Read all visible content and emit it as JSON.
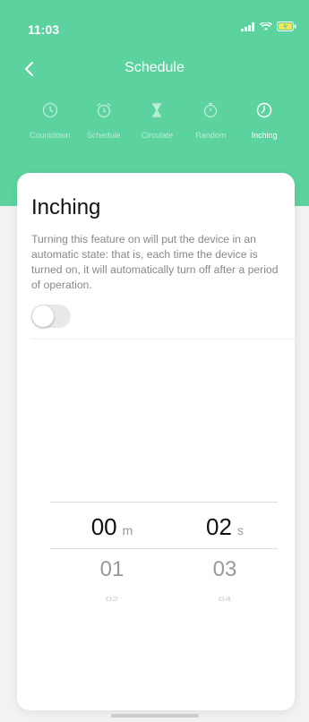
{
  "status": {
    "time": "11:03"
  },
  "header": {
    "title": "Schedule"
  },
  "tabs": [
    {
      "label": "Countdown",
      "icon": "clock-icon",
      "active": false
    },
    {
      "label": "Schedule",
      "icon": "alarm-clock-icon",
      "active": false
    },
    {
      "label": "Circulate",
      "icon": "hourglass-icon",
      "active": false
    },
    {
      "label": "Random",
      "icon": "stopwatch-icon",
      "active": false
    },
    {
      "label": "Inching",
      "icon": "clock-hand-icon",
      "active": true
    }
  ],
  "card": {
    "title": "Inching",
    "description": "Turning this feature on will put the device in an automatic state: that is, each time the device is turned on, it will automatically turn off after a period of operation.",
    "toggle_on": false
  },
  "picker": {
    "minutes": {
      "selected": "00",
      "unit": "m",
      "next": "01",
      "next2": "02"
    },
    "seconds": {
      "selected": "02",
      "unit": "s",
      "next": "03",
      "next2": "04"
    }
  },
  "colors": {
    "accent": "#5cd39f"
  }
}
